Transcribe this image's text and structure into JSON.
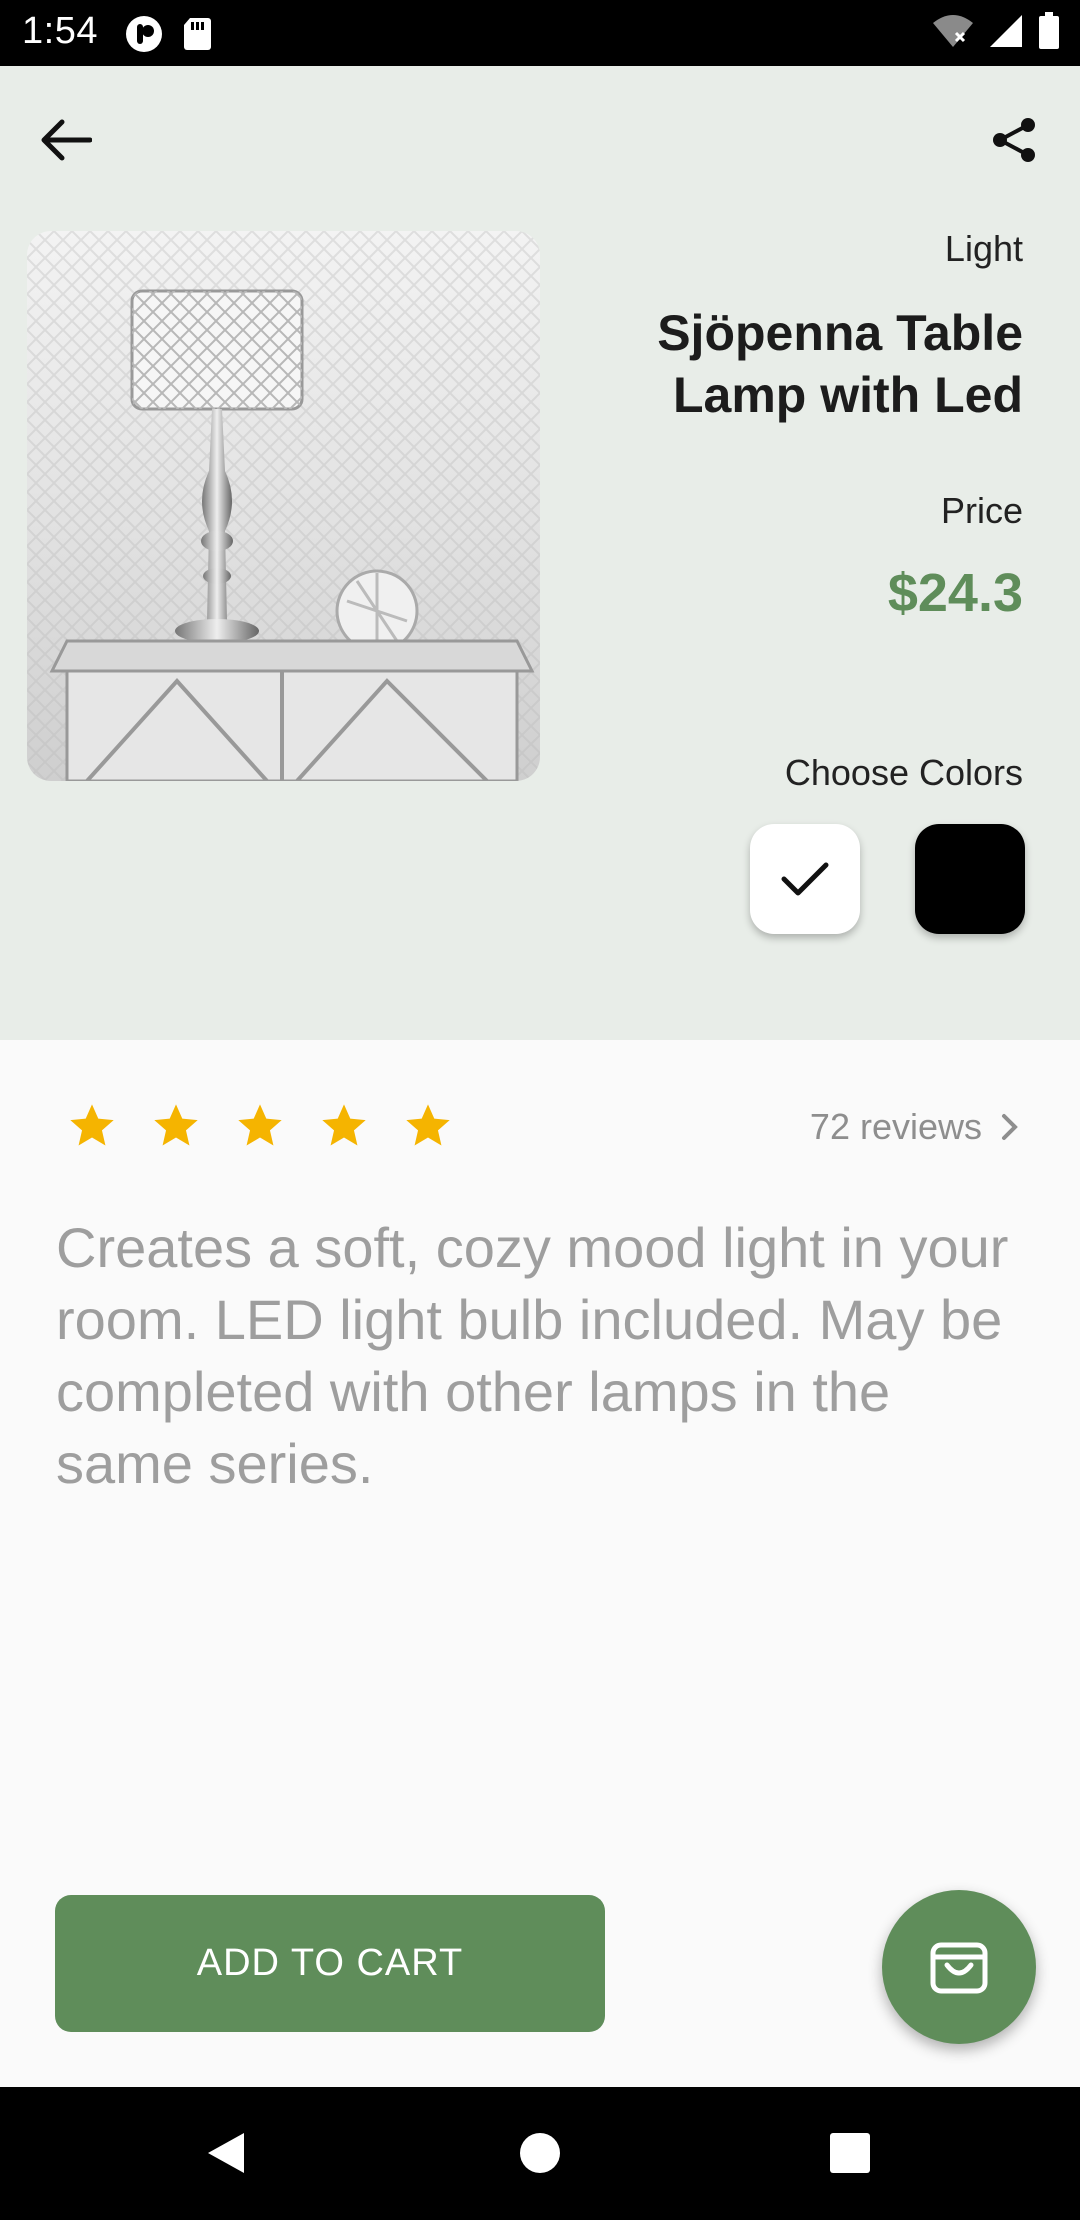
{
  "status_bar": {
    "time": "1:54",
    "icons": [
      "notification-icon",
      "sd-card-icon",
      "wifi-icon",
      "signal-icon",
      "battery-icon"
    ]
  },
  "header": {
    "back_icon": "arrow-left-icon",
    "share_icon": "share-icon"
  },
  "product": {
    "category": "Light",
    "title": "Sjöpenna Table Lamp with Led",
    "price_label": "Price",
    "price": "$24.3",
    "colors_label": "Choose Colors",
    "colors": [
      {
        "value": "#ffffff",
        "selected": true
      },
      {
        "value": "#000000",
        "selected": false
      }
    ],
    "rating": 5,
    "reviews": "72 reviews",
    "description": "Creates a soft, cozy mood light in your room. LED light bulb included. May be completed with other lamps in the same series."
  },
  "actions": {
    "add_to_cart": "ADD TO CART",
    "cart_icon": "shopping-bag-icon"
  },
  "theme": {
    "accent": "#5f8d5a",
    "top_background": "#e8ede8",
    "star_color": "#f5b400"
  },
  "nav_bar": {
    "icons": [
      "back-triangle-icon",
      "home-circle-icon",
      "recents-square-icon"
    ]
  }
}
